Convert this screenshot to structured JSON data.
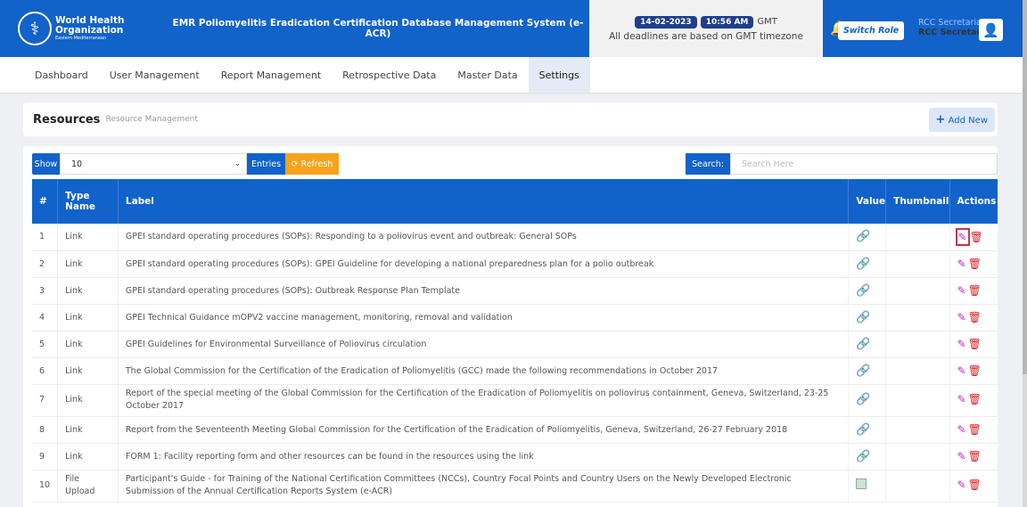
{
  "header": {
    "org_line1": "World Health",
    "org_line2": "Organization",
    "org_line3": "Eastern Mediterranean",
    "system_title": "EMR Poliomyelitis Eradication Certification Database Management System (e-ACR)",
    "date": "14-02-2023",
    "time": "10:56 AM",
    "tz": "GMT",
    "deadline_note": "All deadlines are based on GMT timezone",
    "switch_role": "Switch Role",
    "user_role": "RCC Secretariat",
    "user_name": "RCC Secretariat"
  },
  "nav": {
    "items": [
      "Dashboard",
      "User Management",
      "Report Management",
      "Retrospective Data",
      "Master Data",
      "Settings"
    ],
    "active": "Settings"
  },
  "page": {
    "title": "Resources",
    "subtitle": "Resource Management",
    "add_new": "Add New"
  },
  "controls": {
    "show_label": "Show",
    "entries_value": "10",
    "entries_label": "Entries",
    "refresh_label": "Refresh",
    "search_label": "Search:",
    "search_placeholder": "Search Here"
  },
  "table": {
    "columns": [
      "#",
      "Type Name",
      "Label",
      "Value",
      "Thumbnail",
      "Actions"
    ],
    "rows": [
      {
        "num": "1",
        "type": "Link",
        "label": "GPEI standard operating procedures (SOPs): Responding to a poliovirus event and outbreak: General SOPs",
        "value_icon": "link-icon"
      },
      {
        "num": "2",
        "type": "Link",
        "label": "GPEI standard operating procedures (SOPs): GPEI Guideline for developing a national preparedness plan for a polio outbreak",
        "value_icon": "link-icon"
      },
      {
        "num": "3",
        "type": "Link",
        "label": "GPEI standard operating procedures (SOPs): Outbreak Response Plan Template",
        "value_icon": "link-icon"
      },
      {
        "num": "4",
        "type": "Link",
        "label": "GPEI Technical Guidance mOPV2 vaccine management, monitoring, removal and validation",
        "value_icon": "link-icon"
      },
      {
        "num": "5",
        "type": "Link",
        "label": "GPEI Guidelines for Environmental Surveillance of Poliovirus circulation",
        "value_icon": "link-icon"
      },
      {
        "num": "6",
        "type": "Link",
        "label": "The Global Commission for the Certification of the Eradication of Poliomyelitis (GCC) made the following recommendations in October 2017",
        "value_icon": "link-icon"
      },
      {
        "num": "7",
        "type": "Link",
        "label": "Report of the special meeting of the Global Commission for the Certification of the Eradication of Poliomyelitis on poliovirus containment, Geneva, Switzerland, 23-25 October 2017",
        "value_icon": "link-icon"
      },
      {
        "num": "8",
        "type": "Link",
        "label": "Report from the Seventeenth Meeting Global Commission for the Certification of the Eradication of Poliomyelitis, Geneva, Switzerland, 26-27 February 2018",
        "value_icon": "link-icon"
      },
      {
        "num": "9",
        "type": "Link",
        "label": "FORM 1: Facility reporting form and other resources can be found in the resources using the link",
        "value_icon": "link-icon"
      },
      {
        "num": "10",
        "type": "File Upload",
        "label": "Participant's Guide - for Training of the National Certification Committees (NCCs), Country Focal Points and Country Users on the Newly Developed Electronic Submission of the Annual Certification Reports System (e-ACR)",
        "value_icon": "broken-image-icon"
      }
    ]
  },
  "colors": {
    "primary": "#1162c9",
    "refresh": "#f7a21b",
    "edit": "#c620cf",
    "delete": "#d8232a"
  }
}
